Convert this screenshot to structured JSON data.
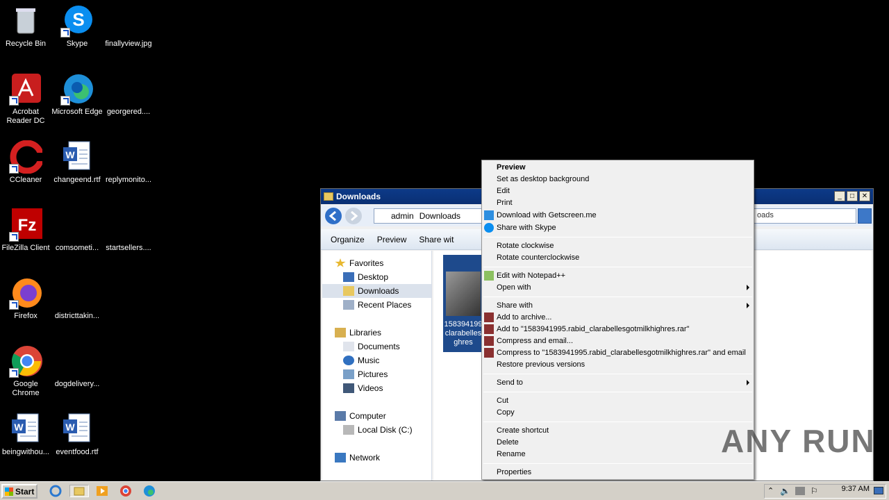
{
  "desktop": {
    "icons": [
      {
        "label": "Recycle Bin"
      },
      {
        "label": "Skype"
      },
      {
        "label": "finallyview.jpg"
      },
      {
        "label": "Acrobat Reader DC"
      },
      {
        "label": "Microsoft Edge"
      },
      {
        "label": "georgered...."
      },
      {
        "label": "CCleaner"
      },
      {
        "label": "changeend.rtf"
      },
      {
        "label": "replymonito..."
      },
      {
        "label": "FileZilla Client"
      },
      {
        "label": "comsometi..."
      },
      {
        "label": "startsellers...."
      },
      {
        "label": "Firefox"
      },
      {
        "label": "districttakin..."
      },
      {
        "label": "Google Chrome"
      },
      {
        "label": "dogdelivery..."
      },
      {
        "label": "beingwithou..."
      },
      {
        "label": "eventfood.rtf"
      }
    ]
  },
  "explorer": {
    "title": "Downloads",
    "breadcrumb": [
      "admin",
      "Downloads"
    ],
    "search_value": "oads",
    "toolbar": {
      "organize": "Organize",
      "preview": "Preview",
      "share": "Share wit"
    },
    "nav": {
      "favorites": "Favorites",
      "desktop": "Desktop",
      "downloads": "Downloads",
      "recent": "Recent Places",
      "libraries": "Libraries",
      "documents": "Documents",
      "music": "Music",
      "pictures": "Pictures",
      "videos": "Videos",
      "computer": "Computer",
      "localdisk": "Local Disk (C:)",
      "network": "Network"
    },
    "file": {
      "label_lines": [
        "158394199",
        "clarabelles",
        "ghres"
      ]
    }
  },
  "context_menu": {
    "items": {
      "preview": "Preview",
      "set_bg": "Set as desktop background",
      "edit": "Edit",
      "print": "Print",
      "getscreen": "Download with Getscreen.me",
      "skype": "Share with Skype",
      "rot_cw": "Rotate clockwise",
      "rot_ccw": "Rotate counterclockwise",
      "notepad": "Edit with Notepad++",
      "open_with": "Open with",
      "share_with": "Share with",
      "add_archive": "Add to archive...",
      "add_rar": "Add to \"1583941995.rabid_clarabellesgotmilkhighres.rar\"",
      "compress_email": "Compress and email...",
      "compress_rar_email": "Compress to \"1583941995.rabid_clarabellesgotmilkhighres.rar\" and email",
      "restore": "Restore previous versions",
      "send_to": "Send to",
      "cut": "Cut",
      "copy": "Copy",
      "create_shortcut": "Create shortcut",
      "delete": "Delete",
      "rename": "Rename",
      "properties": "Properties"
    }
  },
  "taskbar": {
    "start": "Start",
    "clock": "9:37 AM"
  },
  "watermark": "ANY RUN"
}
